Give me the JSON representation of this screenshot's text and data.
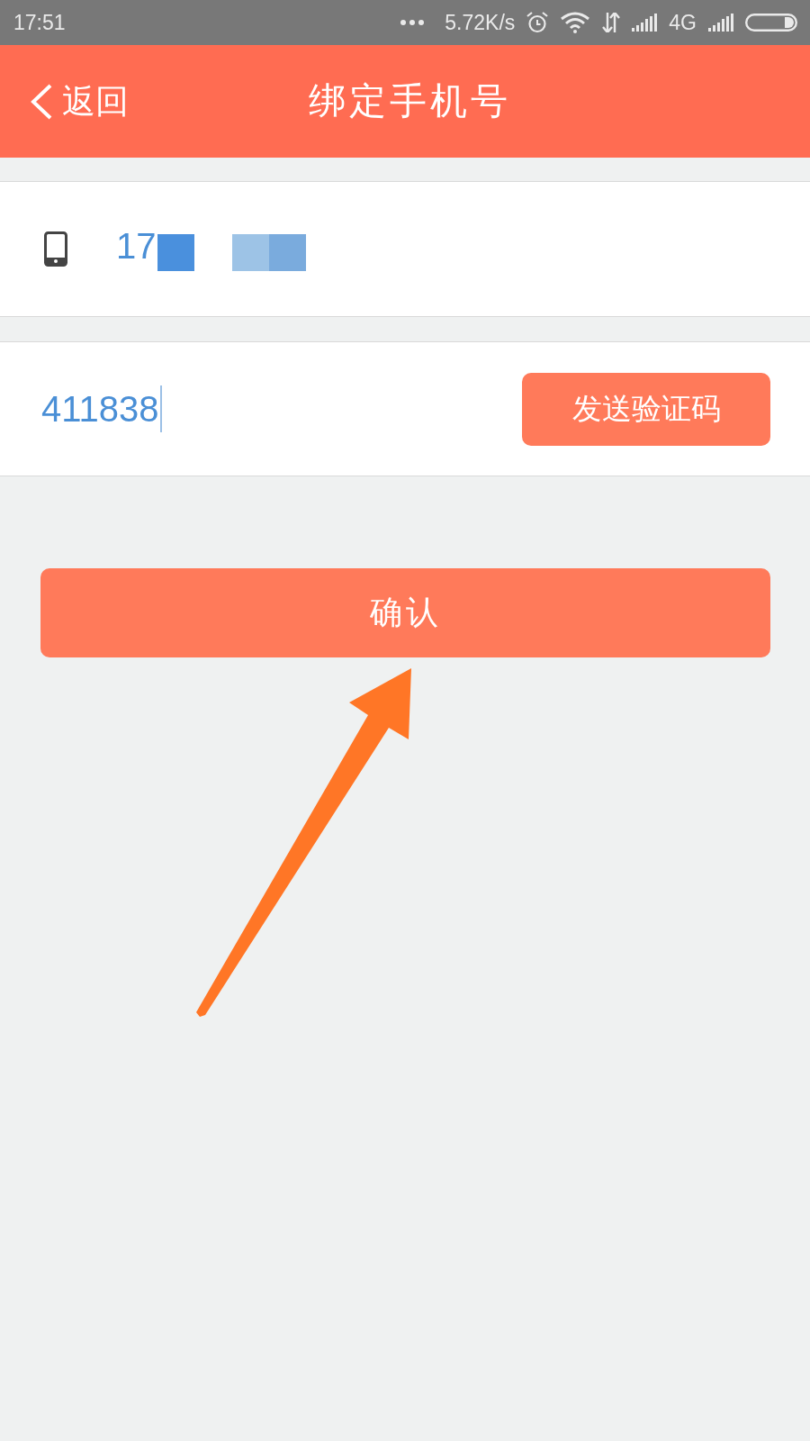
{
  "status_bar": {
    "time": "17:51",
    "network_speed": "5.72K/s",
    "network_type": "4G"
  },
  "header": {
    "back_button": {
      "label": "返回"
    },
    "title": "绑定手机号"
  },
  "phone_field": {
    "value": "17",
    "redacted": true
  },
  "code_field": {
    "value": "411838",
    "focused": true
  },
  "send_code_button": {
    "label": "发送验证码"
  },
  "confirm_button": {
    "label": "确认"
  },
  "annotations": [
    {
      "kind": "arrow"
    }
  ]
}
